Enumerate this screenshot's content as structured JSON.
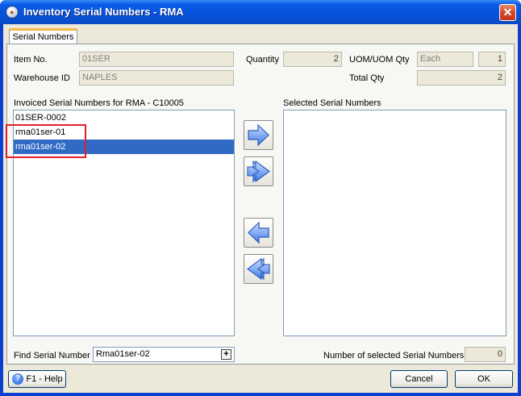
{
  "window": {
    "title": "Inventory Serial Numbers - RMA",
    "close_glyph": "✕",
    "accent": "#0653dc"
  },
  "tab": {
    "label": "Serial Numbers"
  },
  "header": {
    "item_no_label": "Item No.",
    "item_no_value": "01SER",
    "quantity_label": "Quantity",
    "quantity_value": "2",
    "uom_label": "UOM/UOM Qty",
    "uom_value": "Each",
    "uom_qty_value": "1",
    "warehouse_label": "Warehouse ID",
    "warehouse_value": "NAPLES",
    "total_qty_label": "Total Qty",
    "total_qty_value": "2"
  },
  "invoiced": {
    "label": "Invoiced Serial Numbers for RMA - C10005",
    "items": [
      "01SER-0002",
      "rma01ser-01",
      "rma01ser-02"
    ],
    "selected_index": 2
  },
  "selected": {
    "label": "Selected Serial Numbers",
    "items": []
  },
  "transfer_buttons": [
    "arrow-right-icon",
    "double-arrow-right-icon",
    "arrow-left-icon",
    "double-arrow-left-icon"
  ],
  "find": {
    "label": "Find Serial Number",
    "value": "Rma01ser-02",
    "add_glyph": "+"
  },
  "count": {
    "label": "Number of selected Serial Numbers",
    "value": "0"
  },
  "footer": {
    "help_label": "F1 - Help",
    "cancel_label": "Cancel",
    "ok_label": "OK"
  }
}
